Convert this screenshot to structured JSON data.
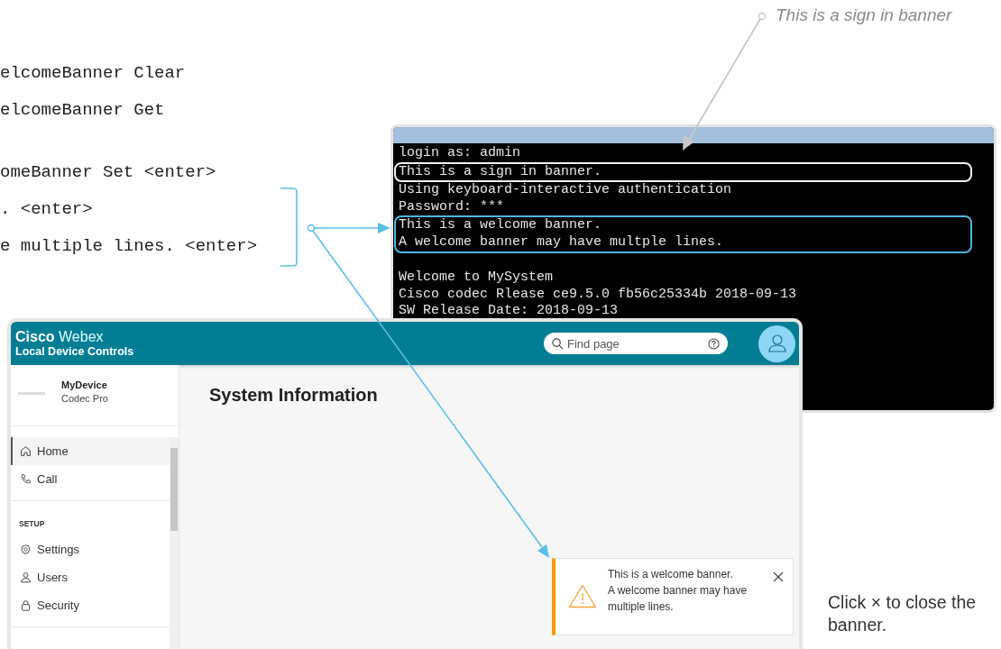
{
  "doc_code_lines": [
    "elcomeBanner Clear",
    "elcomeBanner Get",
    "omeBanner Set <enter>",
    ". <enter>",
    "e multiple lines. <enter>"
  ],
  "callout": {
    "text": "This is a sign in banner"
  },
  "terminal": {
    "blocks": [
      {
        "kind": "plain",
        "lines": [
          "login as: admin"
        ]
      },
      {
        "kind": "sign_in_banner",
        "lines": [
          "This is a sign in banner."
        ]
      },
      {
        "kind": "plain",
        "lines": [
          "Using keyboard-interactive authentication",
          "Password: ***"
        ]
      },
      {
        "kind": "welcome_banner",
        "lines": [
          "This is a welcome banner.",
          "A welcome banner may have multple lines."
        ]
      },
      {
        "kind": "after_gap",
        "lines": [
          "Welcome to MySystem",
          "Cisco codec Rlease ce9.5.0 fb56c25334b 2018-09-13",
          "SW Release Date: 2018-09-13"
        ]
      }
    ]
  },
  "web": {
    "brand": "Cisco",
    "product": "Webex",
    "subtitle": "Local Device Controls",
    "search": {
      "placeholder": "Find page"
    },
    "device": {
      "name": "MyDevice",
      "model": "Codec Pro"
    },
    "nav_sections": [
      {
        "items": [
          {
            "label": "Home",
            "kind": "home",
            "selected": true
          },
          {
            "label": "Call",
            "kind": "call",
            "selected": false
          }
        ]
      },
      {
        "heading": "SETUP",
        "items": [
          {
            "label": "Settings",
            "kind": "settings",
            "selected": false
          },
          {
            "label": "Users",
            "kind": "users",
            "selected": false
          },
          {
            "label": "Security",
            "kind": "security",
            "selected": false
          }
        ]
      }
    ],
    "page_title": "System Information",
    "banner": {
      "lines": [
        "This is a welcome banner.",
        "A welcome banner may have multiple lines."
      ]
    }
  },
  "note": "Click × to close the banner."
}
